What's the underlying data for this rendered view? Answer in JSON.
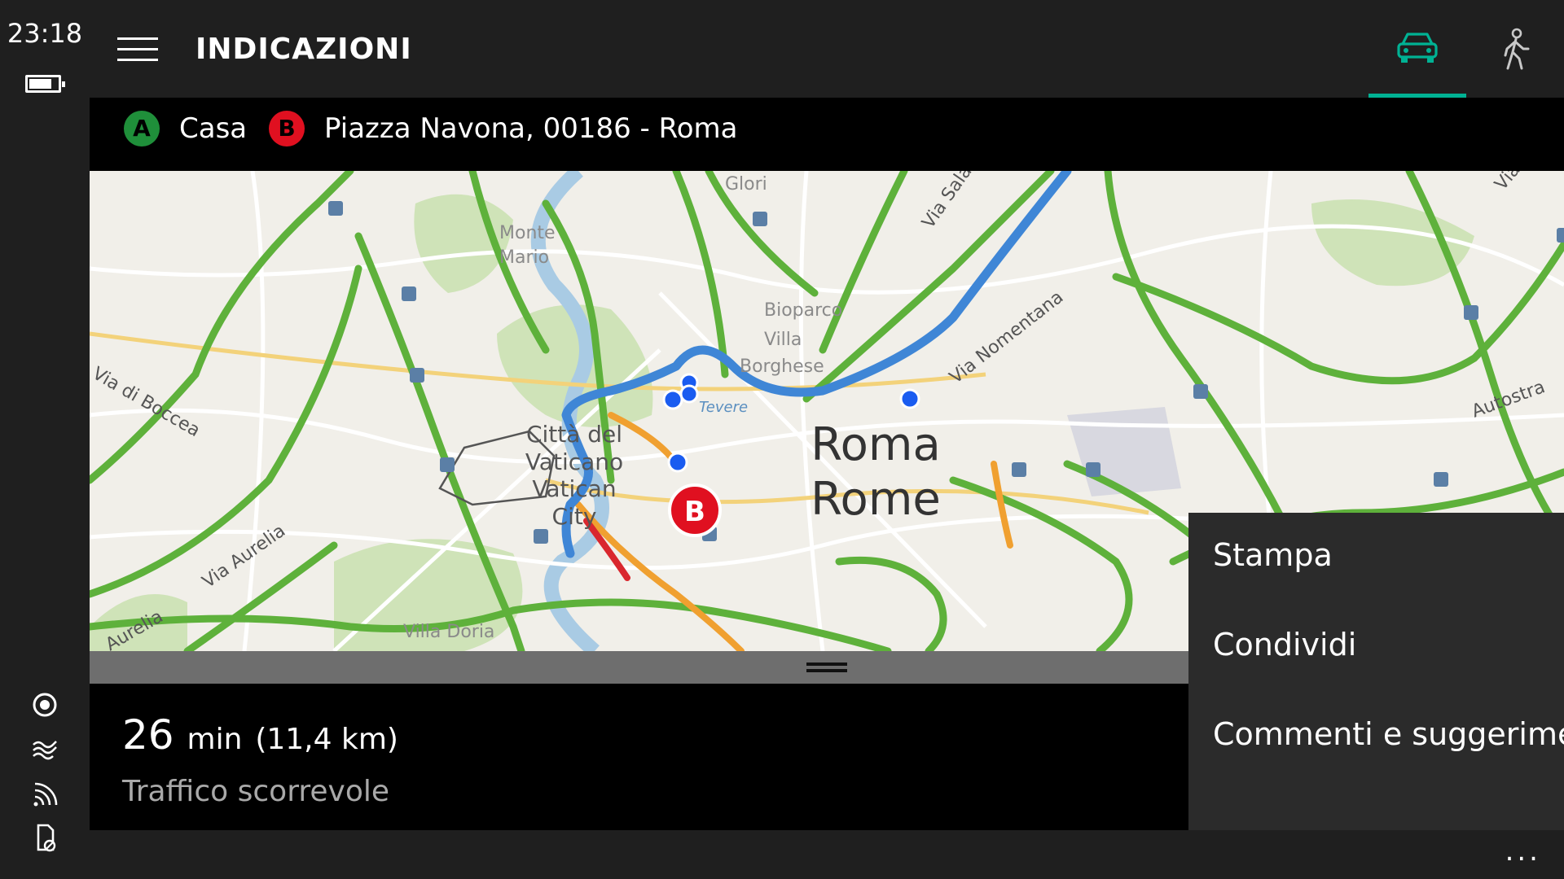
{
  "status": {
    "time": "23:18",
    "battery_level": 0.7
  },
  "header": {
    "title": "INDICAZIONI",
    "mode_active": "car",
    "accent": "#00b294"
  },
  "route": {
    "origin": {
      "marker": "A",
      "label": "Casa",
      "color": "#1f8f3a"
    },
    "destination": {
      "marker": "B",
      "label": "Piazza Navona, 00186 - Roma",
      "color": "#e01020"
    }
  },
  "map": {
    "labels": {
      "glori": "Glori",
      "monte_mario": [
        "Monte",
        "Mario"
      ],
      "via_salaria": "Via Sala",
      "bioparco": "Bioparco",
      "villa_borghese": [
        "Villa",
        "Borghese"
      ],
      "via_nomentana": "Via Nomentana",
      "via_di_boccea": "Via di Boccea",
      "citta_vaticano": [
        "Città del",
        "Vaticano",
        "Vatican",
        "City"
      ],
      "roma": "Roma",
      "rome": "Rome",
      "via_aurelia": "Via Aurelia",
      "aurelia": "Aurelia",
      "villa_doria": "Villa Doria",
      "autostrada": "Autostra",
      "tevere": "Tevere",
      "via_top_right": "Via"
    },
    "destination_marker": "B"
  },
  "summary": {
    "duration": "26",
    "duration_unit": "min",
    "distance": "(11,4 km)",
    "traffic": "Traffico scorrevole"
  },
  "context_menu": {
    "items": [
      "Stampa",
      "Condividi",
      "Commenti e suggerimenti"
    ]
  },
  "appbar": {
    "more": "..."
  }
}
